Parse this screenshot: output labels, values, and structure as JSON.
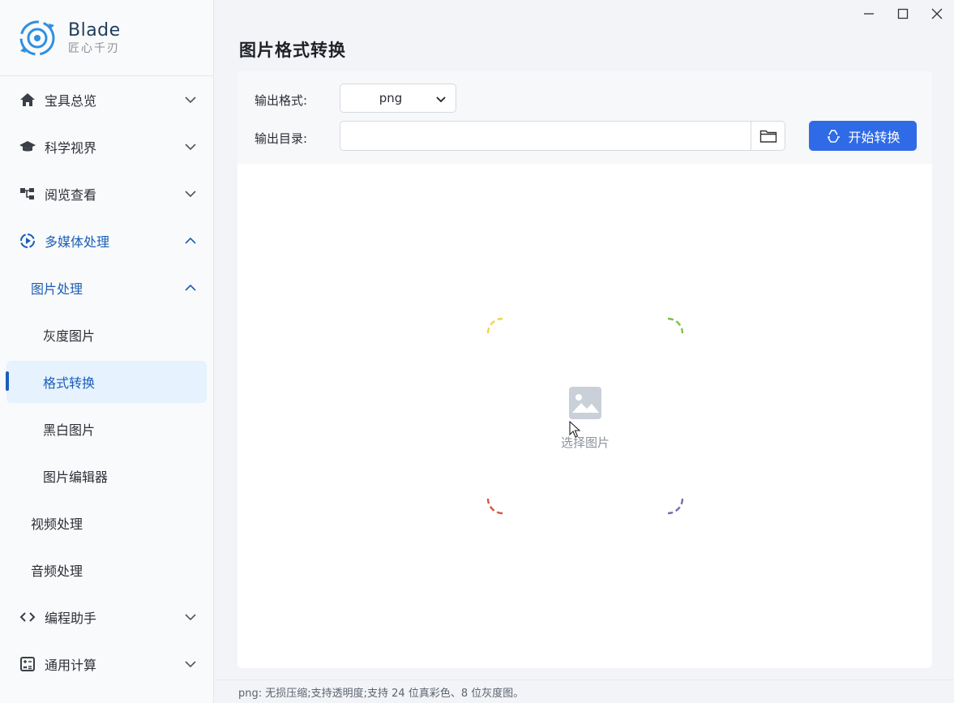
{
  "brand": {
    "name": "Blade",
    "subtitle": "匠心千刃"
  },
  "sidebar": {
    "items": [
      {
        "label": "宝具总览",
        "icon": "home-icon",
        "chevron": "down"
      },
      {
        "label": "科学视界",
        "icon": "graduation-cap-icon",
        "chevron": "down"
      },
      {
        "label": "阅览查看",
        "icon": "sitemap-icon",
        "chevron": "down"
      },
      {
        "label": "多媒体处理",
        "icon": "play-circle-icon",
        "chevron": "up",
        "open": true
      },
      {
        "label": "图片处理",
        "level": 2,
        "chevron": "up",
        "open": true
      },
      {
        "label": "灰度图片",
        "level": 3
      },
      {
        "label": "格式转换",
        "level": 3,
        "active": true
      },
      {
        "label": "黑白图片",
        "level": 3
      },
      {
        "label": "图片编辑器",
        "level": 3
      },
      {
        "label": "视频处理",
        "level": 2
      },
      {
        "label": "音频处理",
        "level": 2
      },
      {
        "label": "编程助手",
        "icon": "code-icon",
        "chevron": "down"
      },
      {
        "label": "通用计算",
        "icon": "calculator-icon",
        "chevron": "down"
      }
    ]
  },
  "page": {
    "title": "图片格式转换"
  },
  "form": {
    "format_label": "输出格式:",
    "format_value": "png",
    "dir_label": "输出目录:",
    "dir_value": "",
    "start_label": "开始转换"
  },
  "dropzone": {
    "label": "选择图片"
  },
  "status": {
    "text": "png: 无损压缩;支持透明度;支持 24 位真彩色、8 位灰度图。"
  },
  "colors": {
    "accent": "#2f6be6",
    "active_text": "#1b5fb8",
    "active_bg": "#e6f2fd",
    "dash_top": "#f2d34e",
    "dash_right": "#7cc04e",
    "dash_bottom": "#e0533f",
    "dash_bottom_right": "#7a6bb0",
    "dash_right_lower": "#3a8ed8"
  }
}
